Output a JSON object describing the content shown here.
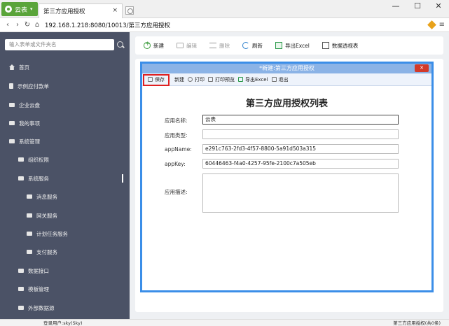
{
  "browser": {
    "app_button": "云表",
    "tab_title": "第三方应用授权",
    "tab_close": "×",
    "url": "192.168.1.218:8080/10013/第三方应用授权",
    "win_min": "—",
    "win_max": "☐",
    "win_close": "✕"
  },
  "sidebar": {
    "search_placeholder": "输入表单或文件夹名",
    "items": [
      {
        "label": "首页"
      },
      {
        "label": "示例应付款单"
      },
      {
        "label": "企业云盘"
      },
      {
        "label": "我的事项"
      },
      {
        "label": "系统管理"
      },
      {
        "label": "组织权限"
      },
      {
        "label": "系统服务"
      },
      {
        "label": "消息服务"
      },
      {
        "label": "网关服务"
      },
      {
        "label": "计划任务服务"
      },
      {
        "label": "支付服务"
      },
      {
        "label": "数据接口"
      },
      {
        "label": "模板管理"
      },
      {
        "label": "外部数据源"
      }
    ]
  },
  "toolbar": {
    "new": "新建",
    "edit": "编辑",
    "delete": "删除",
    "refresh": "刷新",
    "export_excel": "导出Excel",
    "pivot": "数据透视表"
  },
  "dialog": {
    "title": "*新建:第三方应用授权",
    "close": "✕",
    "toolbar": {
      "save": "保存",
      "new": "新建",
      "print": "打印",
      "print_preview": "打印预览",
      "export_excel": "导出Excel",
      "exit": "退出"
    },
    "form_title": "第三方应用授权列表",
    "fields": [
      {
        "label": "应用名称:",
        "value": "云表"
      },
      {
        "label": "应用类型:",
        "value": ""
      },
      {
        "label": "appName:",
        "value": "e291c763-2fd3-4f57-8800-5a91d503a315"
      },
      {
        "label": "appKey:",
        "value": "60446463-f4a0-4257-95fe-2100c7a505eb"
      },
      {
        "label": "应用描述:",
        "value": ""
      }
    ]
  },
  "status": {
    "user": "登录用户:sky(Sky)",
    "record": "第三方应用授权(共0条)"
  },
  "colors": {
    "sidebar_bg": "#4b5266",
    "app_green": "#5aa43a",
    "dialog_border": "#3b8ee8",
    "highlight_red": "#e02020"
  }
}
